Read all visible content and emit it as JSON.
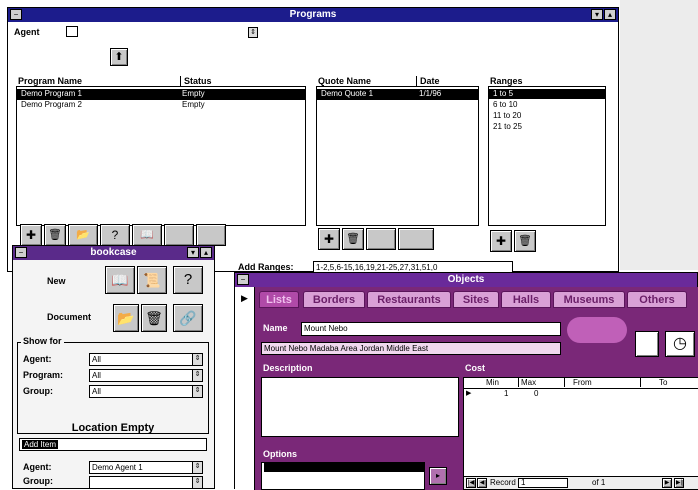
{
  "programs_window": {
    "title": "Programs",
    "agent_label": "Agent",
    "agent_value": "",
    "program_columns": [
      "Program Name",
      "Status"
    ],
    "programs": [
      {
        "name": "Demo Program 1",
        "status": "Empty"
      },
      {
        "name": "Demo Program 2",
        "status": "Empty"
      }
    ],
    "quote_columns": [
      "Quote Name",
      "Date"
    ],
    "quotes": [
      {
        "name": "Demo Quote 1",
        "date": "1/1/96"
      }
    ],
    "ranges_header": "Ranges",
    "ranges": [
      "1 to 5",
      "6 to 10",
      "11 to 20",
      "21 to 25"
    ],
    "add_ranges_label": "Add Ranges:",
    "add_ranges_value": "1-2,5,6-15,16,19,21-25,27,31,51,0"
  },
  "bookcase_window": {
    "title": "bookcase",
    "new_label": "New",
    "document_label": "Document",
    "show_for_label": "Show for",
    "agent_label": "Agent:",
    "agent_value": "All",
    "program_label": "Program:",
    "program_value": "All",
    "group_label": "Group:",
    "group_value": "All",
    "location_label": "Location Empty",
    "location_selected": "Add Item",
    "agent2_label": "Agent:",
    "agent2_value": "Demo Agent 1",
    "group2_label": "Group:",
    "group2_value": ""
  },
  "objects_window": {
    "title": "Objects",
    "tabs": [
      "Lists",
      "Borders",
      "Restaurants",
      "Sites",
      "Halls",
      "Museums",
      "Others"
    ],
    "name_label": "Name",
    "name_value": "Mount Nebo",
    "subtitle_value": "Mount Nebo Madaba Area Jordan Middle East",
    "description_label": "Description",
    "cost_label": "Cost",
    "cost_columns": [
      "Min",
      "Max",
      "From",
      "To"
    ],
    "cost_row": [
      "1",
      "0",
      "",
      ""
    ],
    "options_label": "Options",
    "record_label": "Record",
    "record_value": "1",
    "record_of": "of 1"
  },
  "colors": {
    "titlebar": "#1c1c8c",
    "objects_purple": "#7a2878",
    "tab_pink": "#d9a0d6"
  }
}
